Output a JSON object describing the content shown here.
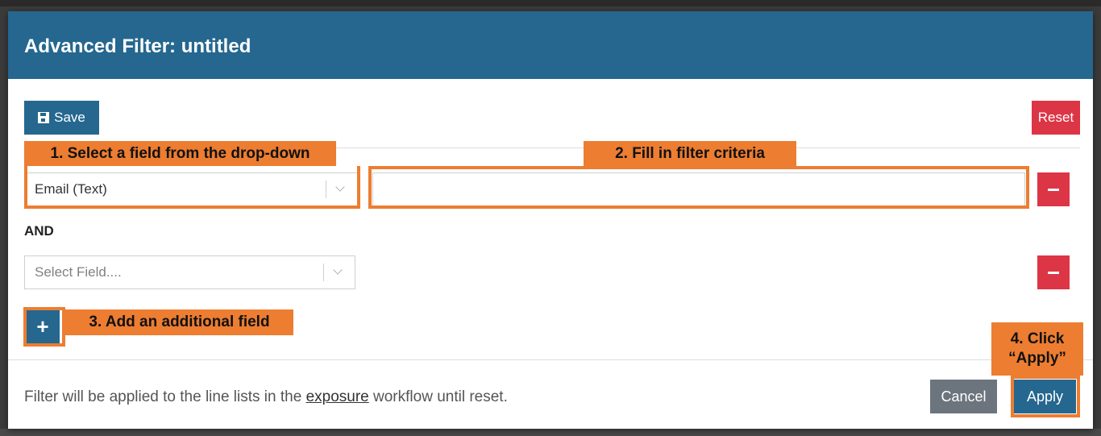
{
  "modal": {
    "title": "Advanced Filter: untitled",
    "save_label": "Save",
    "reset_label": "Reset",
    "and_label": "AND",
    "add_label": "+",
    "footer": {
      "text_before": "Filter will be applied to the line lists in the ",
      "link_text": "exposure",
      "text_after": " workflow until reset.",
      "cancel_label": "Cancel",
      "apply_label": "Apply"
    }
  },
  "filters": [
    {
      "field_value": "Email (Text)",
      "criteria_value": ""
    },
    {
      "field_placeholder": "Select Field....",
      "field_value": ""
    }
  ],
  "annotations": {
    "step1": "1. Select a field from the drop-down",
    "step2": "2. Fill in filter criteria",
    "step3": "3. Add an additional field",
    "step4_line1": "4. Click",
    "step4_line2": "“Apply”"
  },
  "colors": {
    "header": "#25678f",
    "danger": "#dc3545",
    "secondary": "#6c757d",
    "annotation": "#ed7d31"
  },
  "icons": {
    "save": "floppy-disk-icon",
    "dropdown": "chevron-down-icon",
    "remove": "minus-icon",
    "add": "plus-icon"
  }
}
